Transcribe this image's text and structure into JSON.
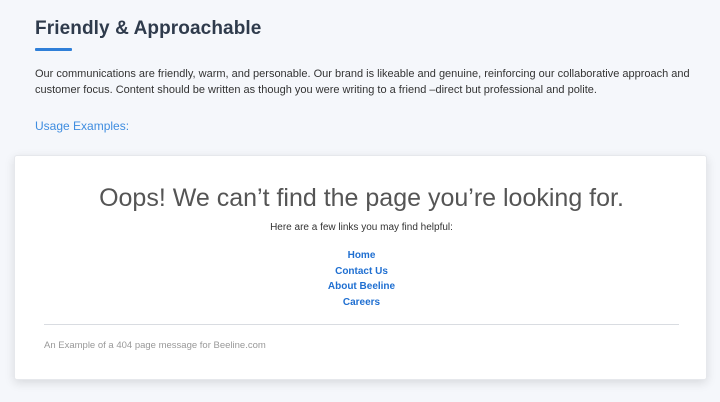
{
  "section": {
    "title": "Friendly & Approachable",
    "description": "Our communications are friendly, warm, and personable. Our brand is likeable and genuine, reinforcing our collaborative approach and customer focus. Content should be written as though you were writing to a friend –direct but professional and polite.",
    "usage_heading": "Usage Examples:"
  },
  "example": {
    "heading": "Oops! We can’t find the page you’re looking for.",
    "helpful_text": "Here are a few links you may find helpful:",
    "links": [
      {
        "label": "Home"
      },
      {
        "label": "Contact Us"
      },
      {
        "label": "About Beeline"
      },
      {
        "label": "Careers"
      }
    ],
    "caption": "An Example of a 404 page message for Beeline.com"
  },
  "colors": {
    "accent": "#2f7fd8",
    "link": "#1f6fd1",
    "background": "#f5f7fb"
  }
}
